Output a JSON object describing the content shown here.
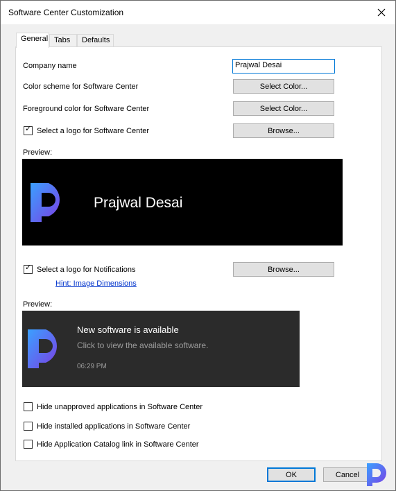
{
  "window": {
    "title": "Software Center Customization"
  },
  "tabs": [
    {
      "label": "General",
      "active": true
    },
    {
      "label": "Tabs",
      "active": false
    },
    {
      "label": "Defaults",
      "active": false
    }
  ],
  "general": {
    "company_name_label": "Company name",
    "company_name_value": "Prajwal Desai",
    "color_scheme_label": "Color scheme for Software Center",
    "color_scheme_button": "Select Color...",
    "foreground_label": "Foreground color for Software Center",
    "foreground_button": "Select Color...",
    "logo_checkbox_label": "Select a logo for Software Center",
    "logo_checked": true,
    "logo_browse_button": "Browse...",
    "preview_label": "Preview:",
    "preview_name": "Prajwal Desai",
    "notif_checkbox_label": "Select a logo for Notifications",
    "notif_checked": true,
    "notif_browse_button": "Browse...",
    "hint_link": "Hint: Image Dimensions",
    "notif_preview_label": "Preview:",
    "notification": {
      "title": "New software is available",
      "subtitle": "Click to view the available software.",
      "time": "06:29 PM"
    },
    "hide_unapproved_label": "Hide unapproved applications in Software Center",
    "hide_installed_label": "Hide installed applications in Software Center",
    "hide_catalog_label": "Hide Application Catalog link in Software Center"
  },
  "footer": {
    "ok_label": "OK",
    "cancel_label": "Cancel"
  },
  "colors": {
    "logo_gradient_start": "#3aa0ff",
    "logo_gradient_end": "#7b3fe4",
    "accent": "#0078d7"
  },
  "icons": [
    "close-icon",
    "checkmark-icon",
    "brand-logo-icon"
  ]
}
